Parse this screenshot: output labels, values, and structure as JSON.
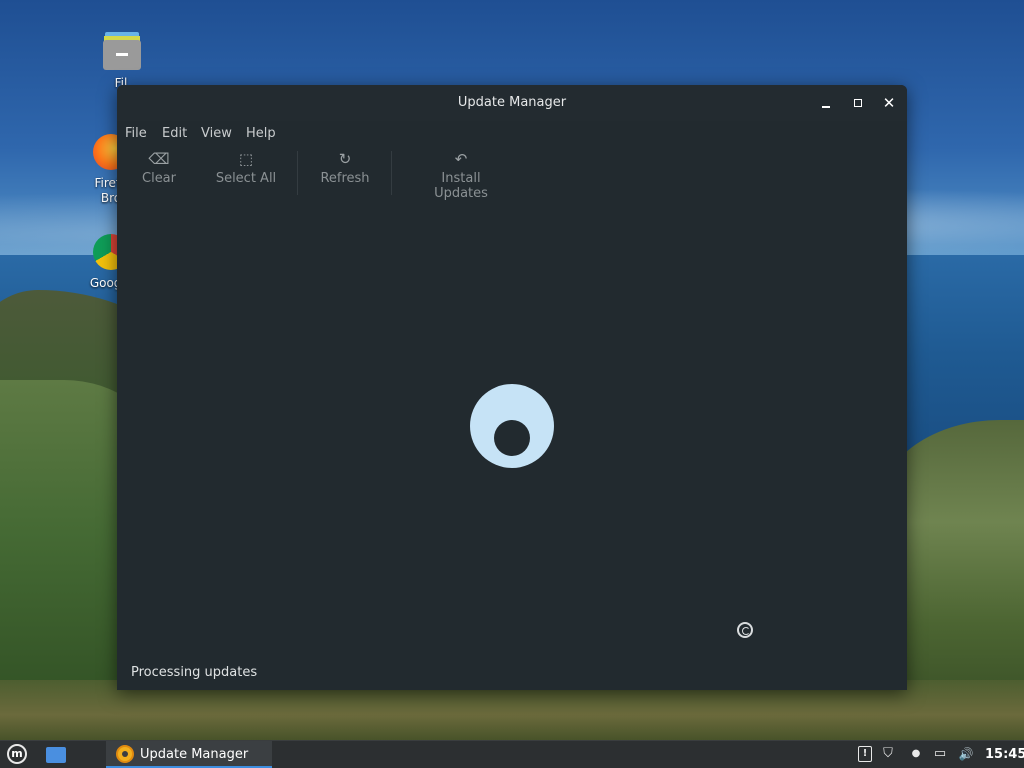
{
  "desktop": {
    "icons": [
      {
        "label": "Fil",
        "icon": "files-folder-icon"
      },
      {
        "label": "Firefo\nBro",
        "icon": "firefox-icon"
      },
      {
        "label": "Google",
        "icon": "chrome-icon"
      }
    ]
  },
  "window": {
    "title": "Update Manager",
    "controls": {
      "minimize": "minimize",
      "maximize": "maximize",
      "close": "✕"
    },
    "menu": [
      "File",
      "Edit",
      "View",
      "Help"
    ],
    "toolbar": [
      {
        "label": "Clear",
        "icon": "backspace-icon",
        "glyph": "⌫"
      },
      {
        "label": "Select All",
        "icon": "select-all-icon",
        "glyph": "⬚"
      },
      {
        "label": "Refresh",
        "icon": "refresh-icon",
        "glyph": "↻"
      },
      {
        "label": "Install Updates",
        "icon": "undo-arrow-icon",
        "glyph": "↶"
      }
    ],
    "status": "Processing updates",
    "colors": {
      "background": "#222a2f",
      "spinner": "#c6e3f6"
    }
  },
  "taskbar": {
    "task": "Update Manager",
    "clock": "15:45",
    "accent": "#3d8ee0",
    "tray": [
      {
        "icon": "clipboard-update-icon",
        "glyph": "!"
      },
      {
        "icon": "shield-icon",
        "glyph": "⛉"
      },
      {
        "icon": "user-icon",
        "glyph": "●"
      },
      {
        "icon": "network-icon",
        "glyph": "▭"
      },
      {
        "icon": "volume-icon",
        "glyph": "🔊"
      }
    ]
  }
}
